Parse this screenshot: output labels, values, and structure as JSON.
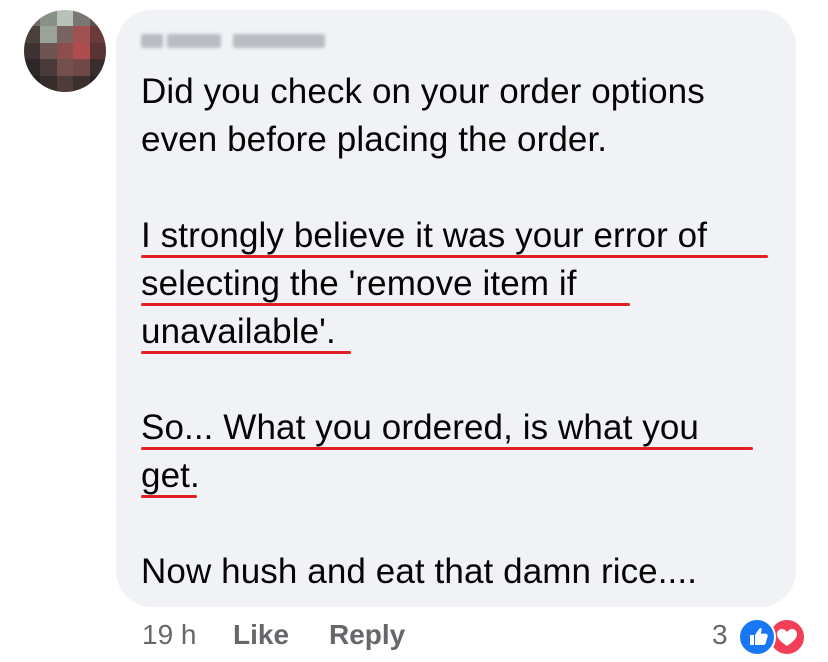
{
  "comment": {
    "lines": [
      "Did you check on your order options",
      "even before placing the order.",
      "I strongly believe it was your error of",
      "selecting the 'remove item if",
      "unavailable'.",
      "So... What you ordered, is what you",
      "get.",
      "Now hush and eat that damn rice...."
    ]
  },
  "meta": {
    "time": "19 h",
    "like_label": "Like",
    "reply_label": "Reply",
    "reaction_count": "3"
  },
  "colors": {
    "bubble": "#f0f2f5",
    "underline": "#e01f26",
    "like_blue": "#1877f2",
    "love_red": "#f33e58",
    "meta_gray": "#65676b"
  },
  "icons": [
    "like-reaction-icon",
    "love-reaction-icon"
  ]
}
